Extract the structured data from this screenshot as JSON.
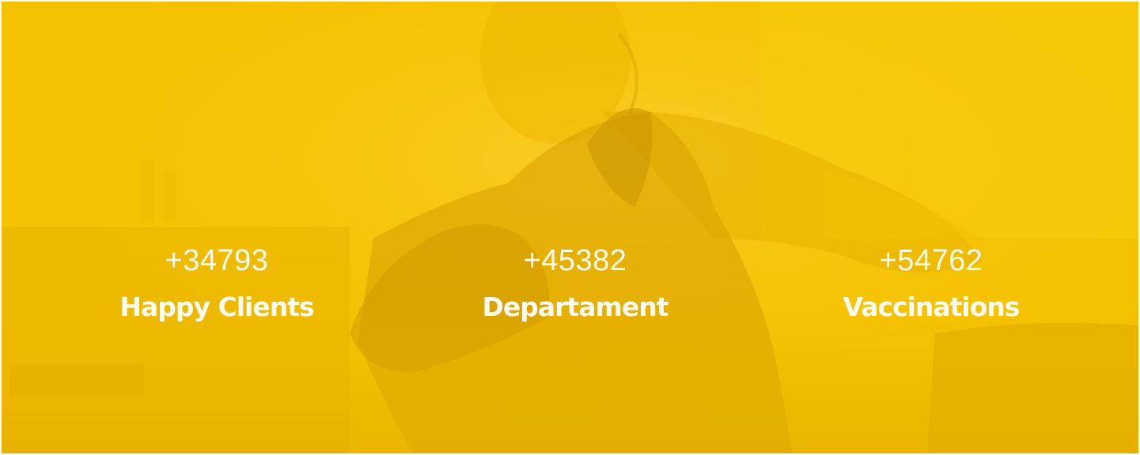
{
  "colors": {
    "overlay": "#f6c400",
    "text": "#ffffff"
  },
  "background": {
    "icon": "vet-with-dog-photo"
  },
  "stats": [
    {
      "number": "+34793",
      "label": "Happy Clients"
    },
    {
      "number": "+45382",
      "label": "Departament"
    },
    {
      "number": "+54762",
      "label": "Vaccinations"
    }
  ]
}
